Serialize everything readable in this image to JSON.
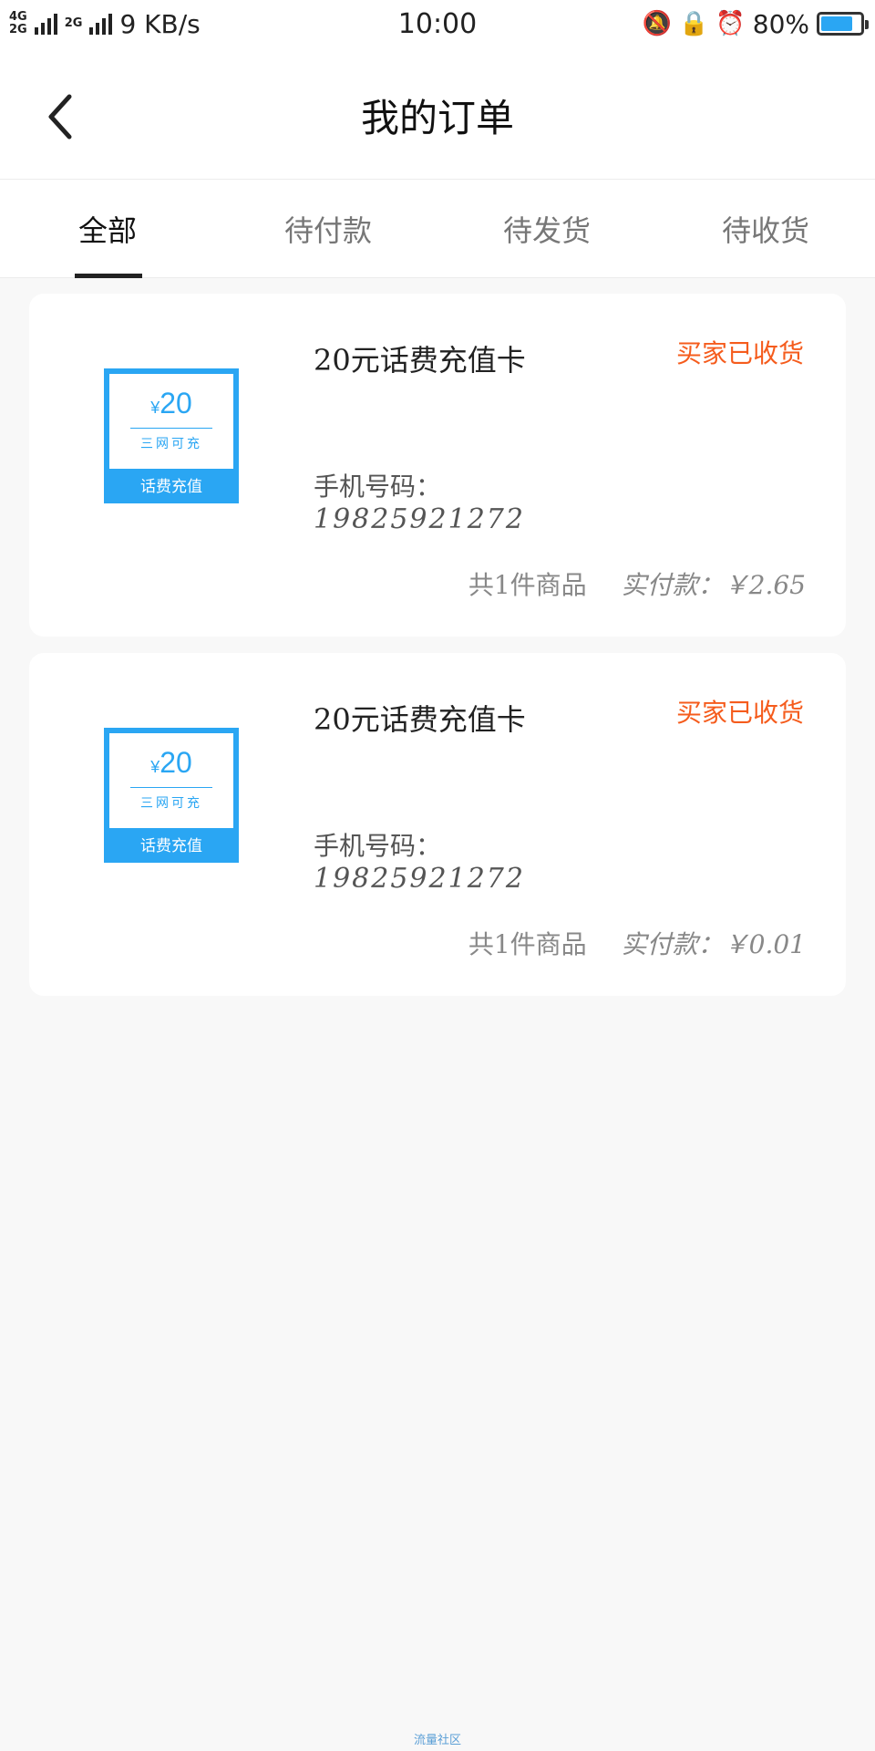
{
  "status_bar": {
    "network_top": "4G",
    "network_bottom": "2G",
    "network_alt": "2G",
    "speed": "9 KB/s",
    "time": "10:00",
    "battery": "80%",
    "battery_level": 0.8
  },
  "header": {
    "title": "我的订单"
  },
  "tabs": [
    {
      "label": "全部",
      "active": true
    },
    {
      "label": "待付款",
      "active": false
    },
    {
      "label": "待发货",
      "active": false
    },
    {
      "label": "待收货",
      "active": false
    }
  ],
  "orders": [
    {
      "thumb_currency": "¥",
      "thumb_amount": "20",
      "thumb_sub": "三网可充",
      "thumb_foot": "话费充值",
      "title": "20元话费充值卡",
      "status": "买家已收货",
      "phone_label": "手机号码：",
      "phone_value": "19825921272",
      "count_text": "共1件商品",
      "total_text": "实付款：￥2.65"
    },
    {
      "thumb_currency": "¥",
      "thumb_amount": "20",
      "thumb_sub": "三网可充",
      "thumb_foot": "话费充值",
      "title": "20元话费充值卡",
      "status": "买家已收货",
      "phone_label": "手机号码：",
      "phone_value": "19825921272",
      "count_text": "共1件商品",
      "total_text": "实付款：￥0.01"
    }
  ],
  "watermark": "流量社区",
  "colors": {
    "accent": "#2aa6f3",
    "status": "#f55c1d"
  }
}
